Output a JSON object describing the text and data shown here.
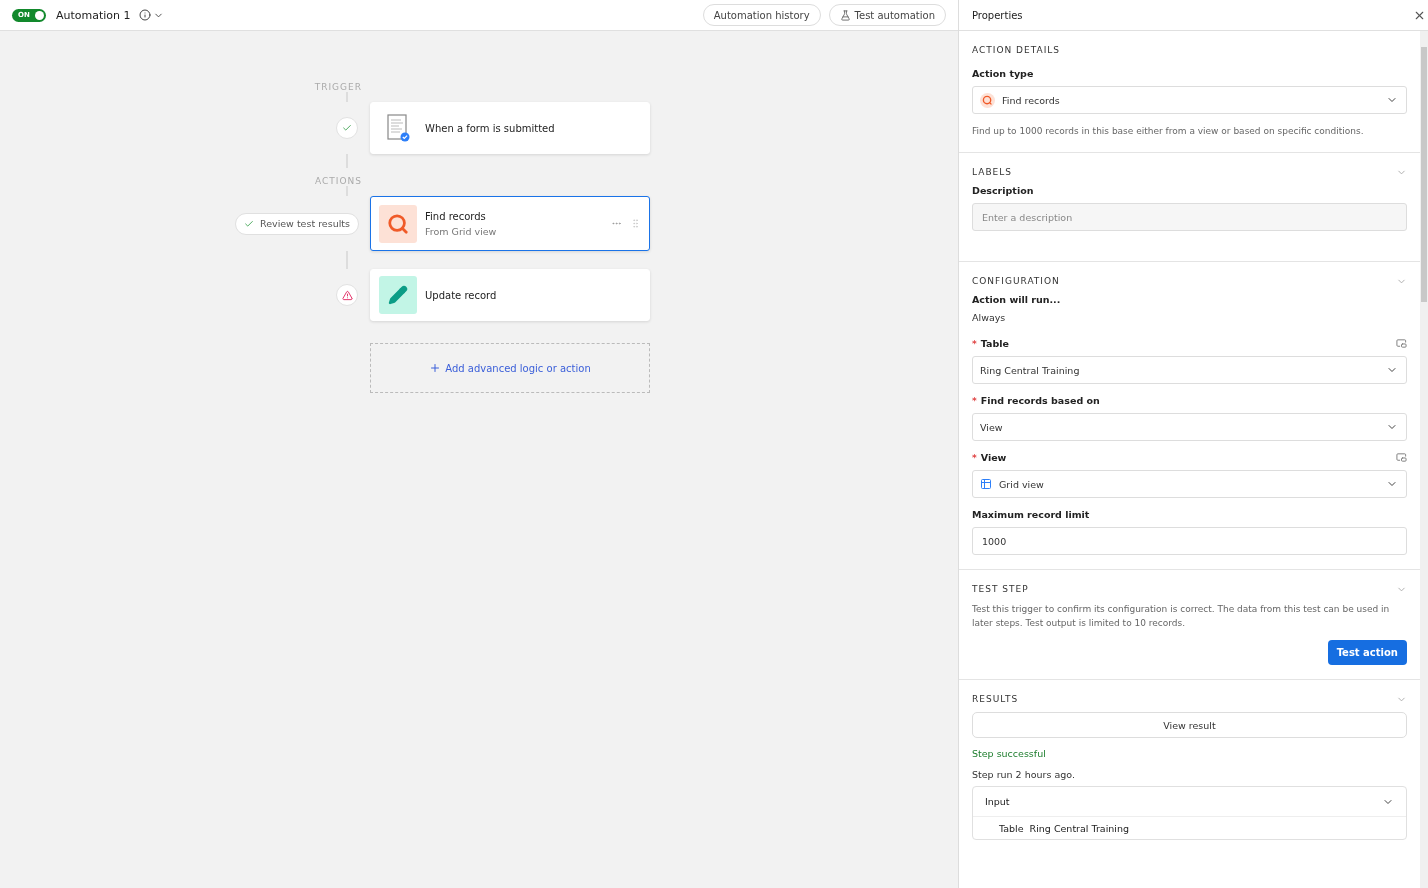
{
  "toolbar": {
    "toggle": {
      "label": "ON",
      "on": true
    },
    "title": "Automation 1",
    "buttons": [
      {
        "label": "Automation history",
        "kind": "plain"
      },
      {
        "label": "Test automation",
        "kind": "flask"
      }
    ]
  },
  "canvas": {
    "sections": [
      {
        "label": "TRIGGER",
        "steps": [
          {
            "kind": "trigger",
            "title": "When a form is submitted",
            "selected": false,
            "status": {
              "kind": "success"
            }
          }
        ]
      },
      {
        "label": "ACTIONS",
        "steps": [
          {
            "kind": "find",
            "title": "Find records",
            "subtitle": "From Grid view",
            "selected": true,
            "status": {
              "kind": "pill",
              "label": "Review test results"
            }
          },
          {
            "kind": "update",
            "title": "Update record",
            "selected": false,
            "status": {
              "kind": "warning"
            }
          }
        ]
      }
    ],
    "add_button": "Add advanced logic or action"
  },
  "panel": {
    "title": "Properties",
    "action_details": {
      "heading": "ACTION DETAILS",
      "label": "Action type",
      "value": "Find records",
      "hint": "Find up to 1000 records in this base either from a view or based on specific conditions."
    },
    "labels": {
      "heading": "LABELS",
      "label": "Description",
      "placeholder": "Enter a description"
    },
    "configuration": {
      "heading": "CONFIGURATION",
      "run_label": "Action will run...",
      "run_value": "Always",
      "fields": [
        {
          "label": "Table",
          "required_mark": "*",
          "kind": "select",
          "value": "Ring Central Training",
          "expand_icon": true
        },
        {
          "label": "Find records based on",
          "required_mark": "*",
          "kind": "select",
          "value": "View",
          "expand_icon": false
        },
        {
          "label": "View",
          "required_mark": "*",
          "kind": "grid-select",
          "value": "Grid view",
          "expand_icon": true
        },
        {
          "label": "Maximum record limit",
          "kind": "input",
          "value": "1000",
          "expand_icon": false
        }
      ]
    },
    "test_step": {
      "heading": "TEST STEP",
      "text": "Test this trigger to confirm its configuration is correct. The data from this test can be used in later steps. Test output is limited to 10 records.",
      "button": "Test action"
    },
    "results": {
      "heading": "RESULTS",
      "view_button": "View result",
      "status": "Step successful",
      "run_time": "Step run 2 hours ago.",
      "input": {
        "title": "Input",
        "rows": [
          {
            "key": "Table",
            "value": "Ring Central Training"
          }
        ]
      }
    }
  }
}
